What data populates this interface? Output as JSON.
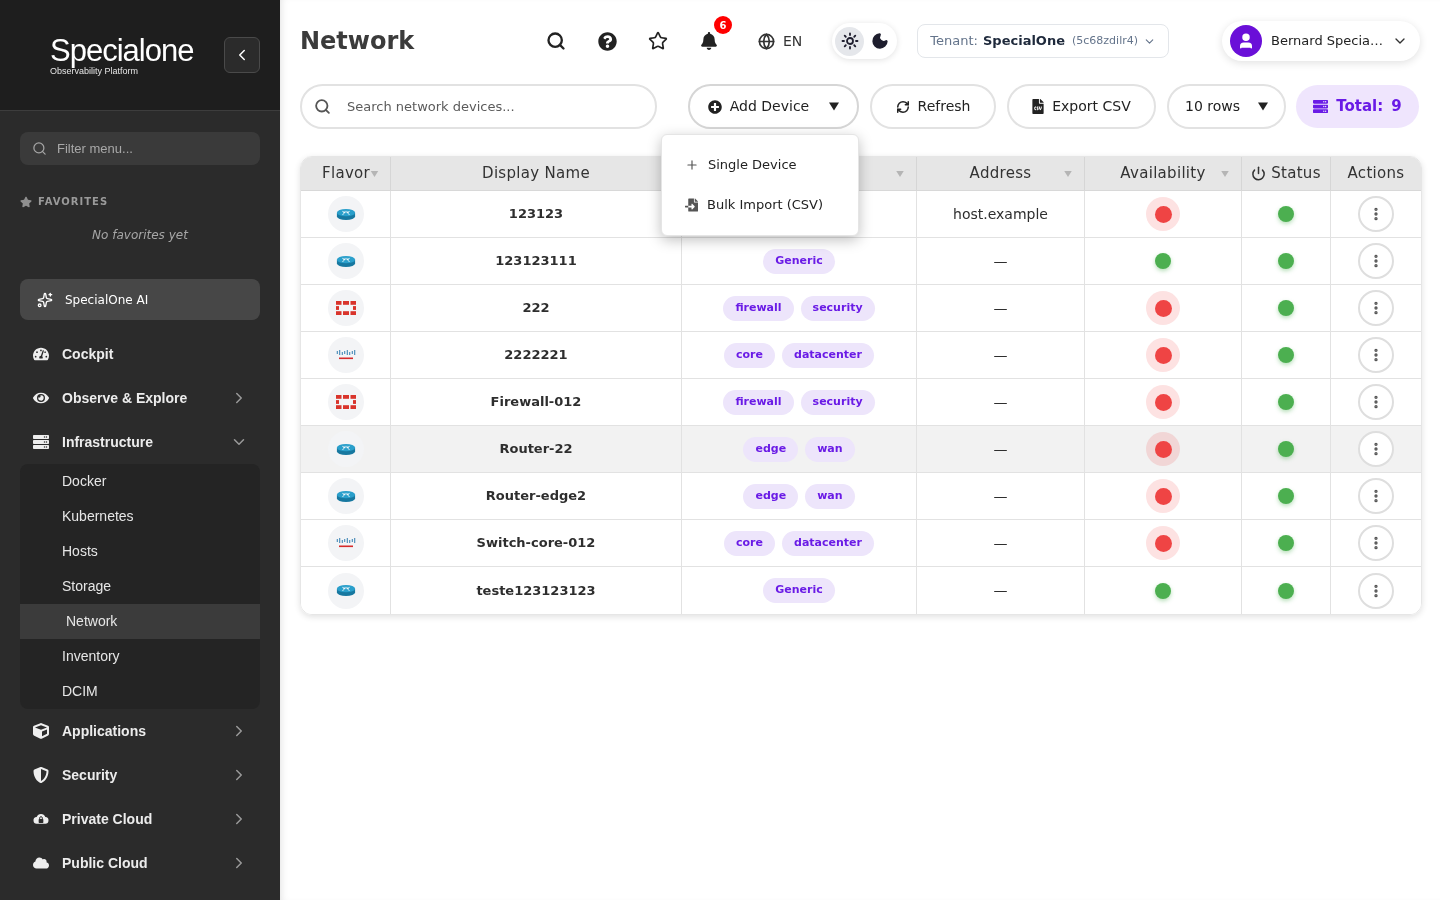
{
  "sidebar": {
    "logo": {
      "name": "Specialone",
      "tagline": "Observability Platform"
    },
    "filter": {
      "placeholder": "Filter menu..."
    },
    "favorites": {
      "heading": "FAVORITES",
      "empty_text": "No favorites yet"
    },
    "ai_button": "SpecialOne AI",
    "nav": [
      {
        "kind": "link",
        "label": "Cockpit"
      },
      {
        "kind": "group",
        "label": "Observe & Explore",
        "expanded": false
      },
      {
        "kind": "group",
        "label": "Infrastructure",
        "expanded": true,
        "children": [
          {
            "label": "Docker",
            "selected": false
          },
          {
            "label": "Kubernetes",
            "selected": false
          },
          {
            "label": "Hosts",
            "selected": false
          },
          {
            "label": "Storage",
            "selected": false
          },
          {
            "label": "Network",
            "selected": true
          },
          {
            "label": "Inventory",
            "selected": false
          },
          {
            "label": "DCIM",
            "selected": false
          }
        ]
      },
      {
        "kind": "group",
        "label": "Applications",
        "expanded": false
      },
      {
        "kind": "group",
        "label": "Security",
        "expanded": false
      },
      {
        "kind": "group",
        "label": "Private Cloud",
        "expanded": false
      },
      {
        "kind": "group",
        "label": "Public Cloud",
        "expanded": false
      }
    ]
  },
  "header": {
    "title": "Network",
    "notifications": {
      "count": "6"
    },
    "language": "EN",
    "theme": [
      {
        "kind": "light",
        "selected": true
      },
      {
        "kind": "dark",
        "selected": false
      }
    ],
    "tenant": {
      "label": "Tenant:",
      "name": "SpecialOne",
      "id": "(5c68zdilr4)"
    },
    "user": {
      "name": "Bernard Specia…"
    }
  },
  "toolbar": {
    "search": {
      "placeholder": "Search network devices..."
    },
    "add_device": {
      "label": "Add Device",
      "expanded": true,
      "menu": [
        {
          "kind": "single",
          "label": "Single Device"
        },
        {
          "kind": "import",
          "label": "Bulk Import (CSV)"
        }
      ]
    },
    "refresh": "Refresh",
    "export": "Export CSV",
    "page_size": "10 rows",
    "total": {
      "label": "Total:",
      "value": "9"
    }
  },
  "table": {
    "columns": [
      {
        "label": "Flavor",
        "sortable": true
      },
      {
        "label": "Display Name",
        "sortable": false
      },
      {
        "sortable": true
      },
      {
        "label": "Address",
        "sortable": true
      },
      {
        "label": "Availability",
        "sortable": true
      },
      {
        "label": "Status",
        "sortable": false
      },
      {
        "label": "Actions",
        "sortable": false
      }
    ],
    "rows": [
      {
        "kind": "router",
        "name": "123123",
        "address": "host.example",
        "available": false,
        "online": true,
        "hovered": false
      },
      {
        "kind": "router",
        "name": "123123111",
        "tags": [
          "Generic"
        ],
        "address": "—",
        "available": true,
        "online": true,
        "hovered": false
      },
      {
        "kind": "firewall",
        "name": "222",
        "tags": [
          "firewall",
          "security"
        ],
        "address": "—",
        "available": false,
        "online": true,
        "hovered": false
      },
      {
        "kind": "switch",
        "name": "2222221",
        "tags": [
          "core",
          "datacenter"
        ],
        "address": "—",
        "available": false,
        "online": true,
        "hovered": false
      },
      {
        "kind": "firewall",
        "name": "Firewall-012",
        "tags": [
          "firewall",
          "security"
        ],
        "address": "—",
        "available": false,
        "online": true,
        "hovered": false
      },
      {
        "kind": "router",
        "name": "Router-22",
        "tags": [
          "edge",
          "wan"
        ],
        "address": "—",
        "available": false,
        "online": true,
        "hovered": true
      },
      {
        "kind": "router",
        "name": "Router-edge2",
        "tags": [
          "edge",
          "wan"
        ],
        "address": "—",
        "available": false,
        "online": true,
        "hovered": false
      },
      {
        "kind": "switch",
        "name": "Switch-core-012",
        "tags": [
          "core",
          "datacenter"
        ],
        "address": "—",
        "available": false,
        "online": true,
        "hovered": false
      },
      {
        "kind": "router",
        "name": "teste123123123",
        "tags": [
          "Generic"
        ],
        "address": "—",
        "available": true,
        "online": true,
        "hovered": false
      }
    ]
  }
}
